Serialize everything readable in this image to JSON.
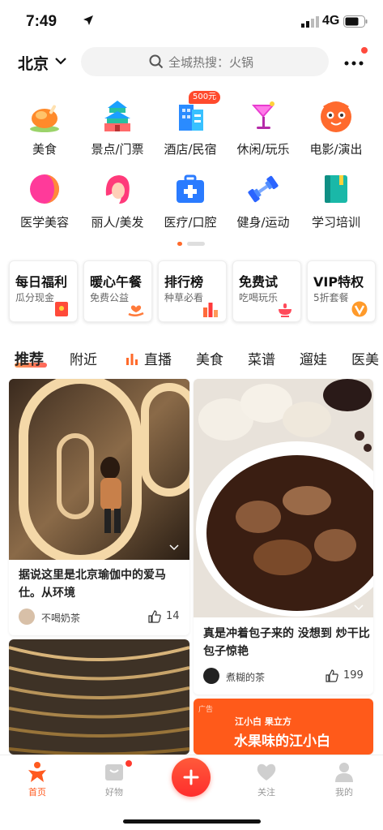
{
  "status_bar": {
    "time": "7:49",
    "network": "4G"
  },
  "header": {
    "city": "北京",
    "search_placeholder": "全城热搜：火锅"
  },
  "categories": [
    {
      "label": "美食",
      "icon": "roast-chicken-icon"
    },
    {
      "label": "景点/门票",
      "icon": "temple-icon"
    },
    {
      "label": "酒店/民宿",
      "icon": "hotel-icon",
      "badge": "500元"
    },
    {
      "label": "休闲/玩乐",
      "icon": "cocktail-icon"
    },
    {
      "label": "电影/演出",
      "icon": "cat-mask-icon"
    },
    {
      "label": "医学美容",
      "icon": "beauty-face-icon"
    },
    {
      "label": "丽人/美发",
      "icon": "hair-icon"
    },
    {
      "label": "医疗/口腔",
      "icon": "medical-kit-icon"
    },
    {
      "label": "健身/运动",
      "icon": "dumbbell-icon"
    },
    {
      "label": "学习培训",
      "icon": "book-icon"
    }
  ],
  "promos": [
    {
      "title": "每日福利",
      "subtitle": "瓜分现金",
      "icon": "red-envelope-icon"
    },
    {
      "title": "暖心午餐",
      "subtitle": "免费公益",
      "icon": "heart-hand-icon"
    },
    {
      "title": "排行榜",
      "subtitle": "种草必看",
      "icon": "bar-rank-icon"
    },
    {
      "title": "免费试",
      "subtitle": "吃喝玩乐",
      "icon": "dish-icon"
    },
    {
      "title": "VIP特权",
      "subtitle": "5折套餐",
      "icon": "vip-badge-icon"
    }
  ],
  "tabs": [
    "推荐",
    "附近",
    "直播",
    "美食",
    "菜谱",
    "遛娃",
    "医美"
  ],
  "feed": {
    "left": [
      {
        "title": "据说这里是北京瑜伽中的爱马仕。从环境",
        "author": "不喝奶茶",
        "likes": "14"
      }
    ],
    "right": [
      {
        "title": "真是冲着包子来的 没想到 炒干比包子惊艳",
        "author": "煮糊的茶",
        "likes": "199"
      }
    ],
    "ad": {
      "label": "广告",
      "brand": "江小白 果立方",
      "title": "水果味的江小白"
    }
  },
  "bottom_nav": [
    {
      "label": "首页",
      "icon": "home-figure-icon",
      "active": true
    },
    {
      "label": "好物",
      "icon": "bag-icon"
    },
    {
      "label": "关注",
      "icon": "heart-icon"
    },
    {
      "label": "我的",
      "icon": "profile-icon"
    }
  ],
  "colors": {
    "accent": "#ff5a1f",
    "fab": "#ff3a2d"
  }
}
